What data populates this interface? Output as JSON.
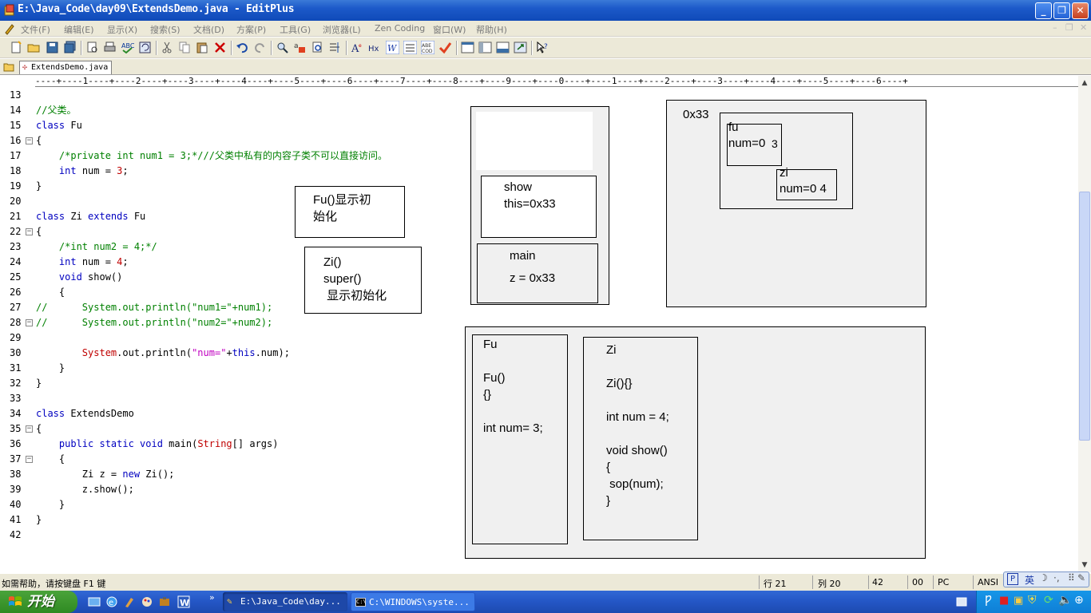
{
  "window": {
    "title": "E:\\Java_Code\\day09\\ExtendsDemo.java - EditPlus",
    "buttons": [
      "minimize",
      "restore",
      "close"
    ]
  },
  "menu": {
    "items": [
      "文件(F)",
      "编辑(E)",
      "显示(X)",
      "搜索(S)",
      "文档(D)",
      "方案(P)",
      "工具(G)",
      "浏览器(L)",
      "Zen Coding",
      "窗口(W)",
      "帮助(H)"
    ]
  },
  "tab": {
    "label": "ExtendsDemo.java"
  },
  "ruler": {
    "text": "----+----1----+----2----+----3----+----4----+----5----+----6----+----7----+----8----+----9----+----0----+----1----+----2----+----3----+----4----+----5----+----6----+"
  },
  "code": {
    "line_numbers": [
      "13",
      "14",
      "15",
      "16",
      "17",
      "18",
      "19",
      "20",
      "21",
      "22",
      "23",
      "24",
      "25",
      "26",
      "27",
      "28",
      "29",
      "30",
      "31",
      "32",
      "33",
      "34",
      "35",
      "36",
      "37",
      "38",
      "39",
      "40",
      "41",
      "42"
    ],
    "fold_lines": [
      "16",
      "22",
      "28",
      "35",
      "37"
    ],
    "lines": [
      [],
      [
        {
          "t": "//父类。",
          "c": "cm"
        }
      ],
      [
        {
          "t": "class",
          "c": "kw"
        },
        {
          "t": " Fu",
          "c": ""
        }
      ],
      [
        {
          "t": "{",
          "c": ""
        }
      ],
      [
        {
          "t": "    /*private int num1 = 3;*///父类中私有的内容子类不可以直接访问。",
          "c": "cm"
        }
      ],
      [
        {
          "t": "    ",
          "c": ""
        },
        {
          "t": "int",
          "c": "kw"
        },
        {
          "t": " num = ",
          "c": ""
        },
        {
          "t": "3",
          "c": "cl"
        },
        {
          "t": ";",
          "c": ""
        }
      ],
      [
        {
          "t": "}",
          "c": ""
        }
      ],
      [],
      [
        {
          "t": "class",
          "c": "kw"
        },
        {
          "t": " Zi ",
          "c": ""
        },
        {
          "t": "extends",
          "c": "kw"
        },
        {
          "t": " Fu",
          "c": ""
        }
      ],
      [
        {
          "t": "{",
          "c": ""
        }
      ],
      [
        {
          "t": "    /*int num2 = 4;*/",
          "c": "cm"
        }
      ],
      [
        {
          "t": "    ",
          "c": ""
        },
        {
          "t": "int",
          "c": "kw"
        },
        {
          "t": " num = ",
          "c": ""
        },
        {
          "t": "4",
          "c": "cl"
        },
        {
          "t": ";",
          "c": ""
        }
      ],
      [
        {
          "t": "    ",
          "c": ""
        },
        {
          "t": "void",
          "c": "kw"
        },
        {
          "t": " show()",
          "c": ""
        }
      ],
      [
        {
          "t": "    {",
          "c": ""
        }
      ],
      [
        {
          "t": "//      System.out.println(\"num1=\"+num1);",
          "c": "cm"
        }
      ],
      [
        {
          "t": "//      System.out.println(\"num2=\"+num2);",
          "c": "cm"
        }
      ],
      [],
      [
        {
          "t": "        ",
          "c": ""
        },
        {
          "t": "System",
          "c": "cl"
        },
        {
          "t": ".out.println(",
          "c": ""
        },
        {
          "t": "\"num=\"",
          "c": "st"
        },
        {
          "t": "+",
          "c": ""
        },
        {
          "t": "this",
          "c": "kw"
        },
        {
          "t": ".num);",
          "c": ""
        }
      ],
      [
        {
          "t": "    }",
          "c": ""
        }
      ],
      [
        {
          "t": "}",
          "c": ""
        }
      ],
      [],
      [
        {
          "t": "class",
          "c": "kw"
        },
        {
          "t": " ExtendsDemo",
          "c": ""
        }
      ],
      [
        {
          "t": "{",
          "c": ""
        }
      ],
      [
        {
          "t": "    ",
          "c": ""
        },
        {
          "t": "public static void",
          "c": "kw"
        },
        {
          "t": " main(",
          "c": ""
        },
        {
          "t": "String",
          "c": "cl"
        },
        {
          "t": "[] args)",
          "c": ""
        }
      ],
      [
        {
          "t": "    {",
          "c": ""
        }
      ],
      [
        {
          "t": "        Zi z = ",
          "c": ""
        },
        {
          "t": "new",
          "c": "kw"
        },
        {
          "t": " Zi();",
          "c": ""
        }
      ],
      [
        {
          "t": "        z.show();",
          "c": ""
        }
      ],
      [
        {
          "t": "    }",
          "c": ""
        }
      ],
      [
        {
          "t": "}",
          "c": ""
        }
      ],
      []
    ]
  },
  "diagram": {
    "fu_init_note": "Fu()显示初\n始化",
    "zi_note": "Zi()\nsuper()\n 显示初始化",
    "stack_show": "show\nthis=0x33",
    "stack_main": "main\n\nz = 0x33",
    "heap_addr": "0x33",
    "heap_fu": "fu\nnum=0",
    "heap_fu_overwrite": "3",
    "heap_zi": "zi\nnum=0 4",
    "method_fu": "Fu\n\nFu()\n{}\n\nint num= 3;",
    "method_zi": "Zi\n\nZi(){}\n\nint num = 4;\n\nvoid show()\n{\n sop(num);\n}"
  },
  "status": {
    "help": "如需帮助，请按键盘 F1 键",
    "row": "行 21",
    "col": "列 20",
    "lines": "42",
    "col2": "00",
    "mode": "PC",
    "encoding": "ANSI"
  },
  "ime": {
    "label": "英"
  },
  "taskbar": {
    "start": "开始",
    "tasks": [
      "E:\\Java_Code\\day...",
      "C:\\WINDOWS\\syste..."
    ]
  }
}
